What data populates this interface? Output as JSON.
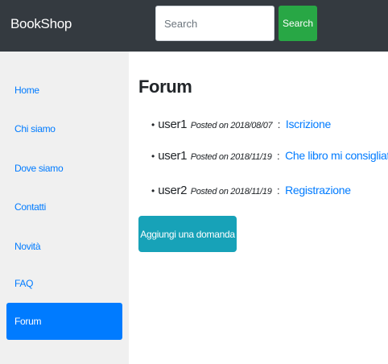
{
  "navbar": {
    "brand": "BookShop",
    "search_placeholder": "Search",
    "search_button": "Search"
  },
  "sidebar": {
    "items": [
      {
        "label": "Home",
        "active": false
      },
      {
        "label": "Chi siamo",
        "active": false
      },
      {
        "label": "Dove siamo",
        "active": false
      },
      {
        "label": "Contatti",
        "active": false
      },
      {
        "label": "Novità",
        "active": false
      },
      {
        "label": "FAQ",
        "active": false
      },
      {
        "label": "Forum",
        "active": true
      }
    ]
  },
  "main": {
    "title": "Forum",
    "posts": [
      {
        "user": "user1",
        "meta": "Posted on 2018/08/07",
        "separator": ":",
        "topic": "Iscrizione"
      },
      {
        "user": "user1",
        "meta": "Posted on 2018/11/19",
        "separator": ":",
        "topic": "Che libro mi consigliate?"
      },
      {
        "user": "user2",
        "meta": "Posted on 2018/11/19",
        "separator": ":",
        "topic": "Registrazione"
      }
    ],
    "ask_button": "Aggiungi una domanda"
  },
  "colors": {
    "navbar": "#343a40",
    "primary": "#007bff",
    "success": "#28a745",
    "info": "#17a2b8",
    "sidebar_bg": "#f0f0f0"
  },
  "icons": [
    "bullet-icon"
  ]
}
